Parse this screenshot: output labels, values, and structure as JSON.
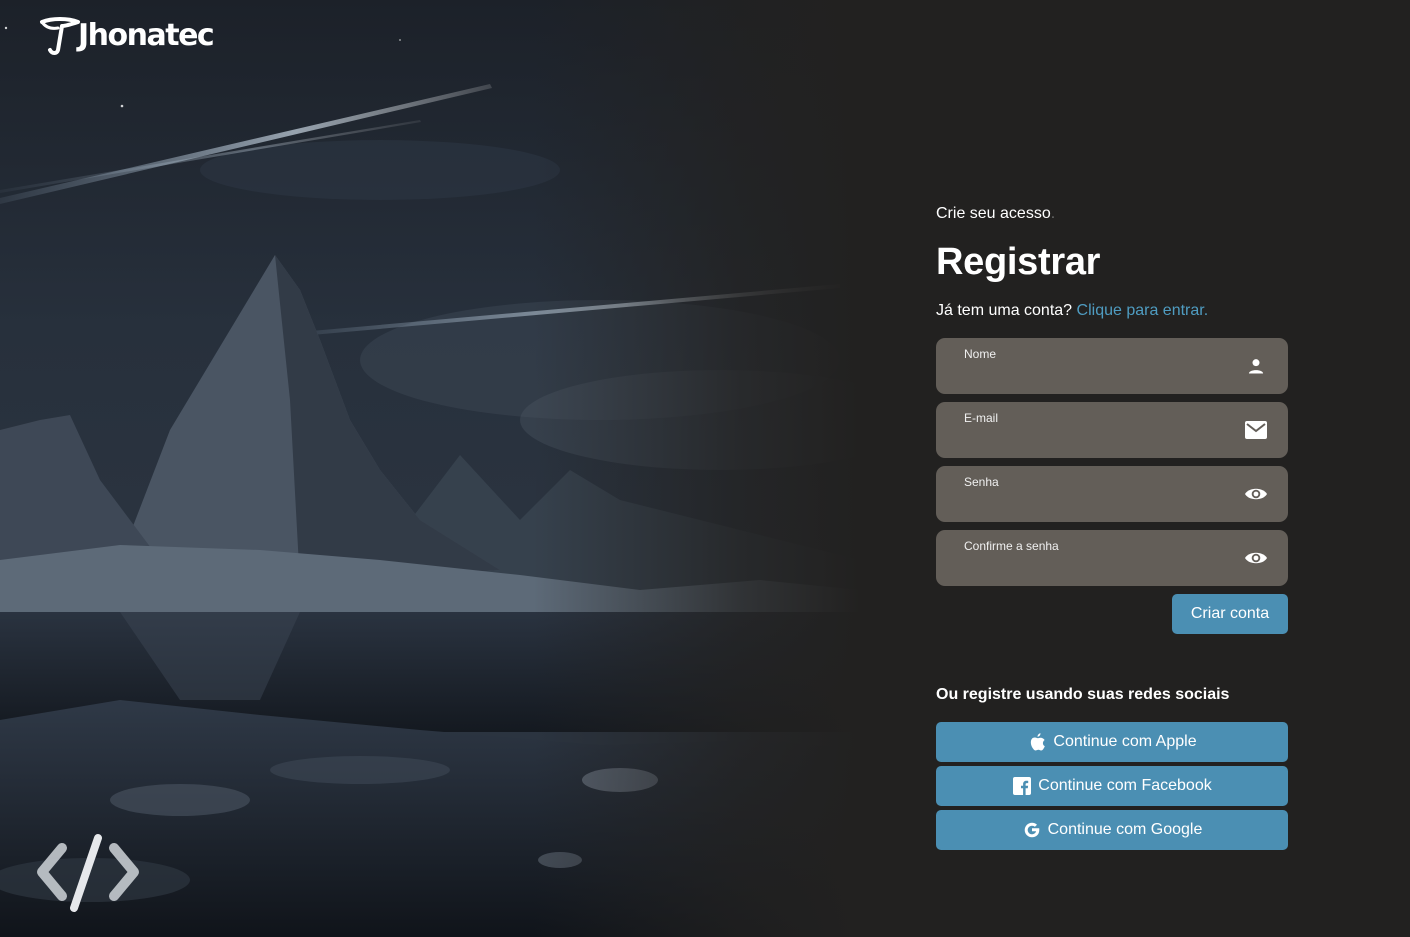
{
  "brand": {
    "name": "Jhonatec"
  },
  "form": {
    "kicker": "Crie seu acesso",
    "kicker_dot": ".",
    "title": "Registrar",
    "have_account": "Já tem uma conta?",
    "signin_link": "Clique para entrar.",
    "fields": [
      {
        "label": "Nome",
        "icon": "person-icon"
      },
      {
        "label": "E-mail",
        "icon": "mail-icon"
      },
      {
        "label": "Senha",
        "icon": "eye-icon"
      },
      {
        "label": "Confirme a senha",
        "icon": "eye-icon"
      }
    ],
    "submit_label": "Criar conta"
  },
  "social": {
    "title": "Ou registre usando suas redes sociais",
    "apple": "Continue com Apple",
    "facebook": "Continue com Facebook",
    "google": "Continue com Google"
  },
  "colors": {
    "background": "#222120",
    "field_bg": "#635e58",
    "accent": "#4b8fb3",
    "link": "#4f9cc1"
  }
}
